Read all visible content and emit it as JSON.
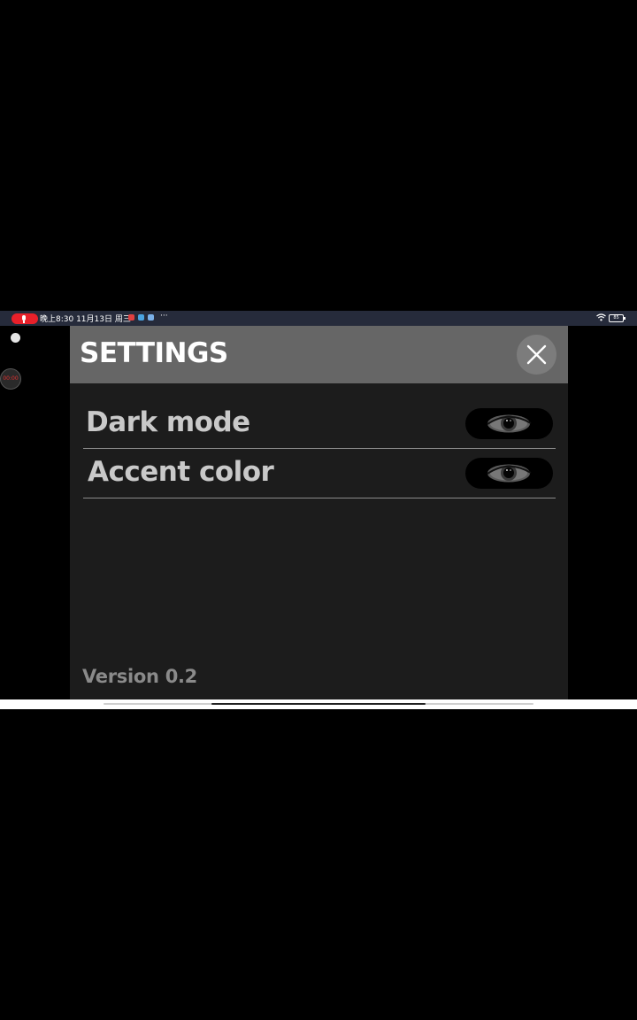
{
  "status_bar": {
    "time_text": "晚上8:30 11月13日 周三",
    "more_text": "···",
    "battery_text": "85",
    "app_icons": [
      "#e04040",
      "#4aa3e0",
      "#7ab0e8"
    ]
  },
  "floating": {
    "timer_text": "00:00"
  },
  "settings": {
    "title": "SETTINGS",
    "items": [
      {
        "label": "Dark mode"
      },
      {
        "label": "Accent color"
      }
    ],
    "version": "Version 0.2"
  },
  "colors": {
    "header_bg": "#666666",
    "panel_bg": "#1c1c1c",
    "label_text": "#c9c9c9",
    "status_bar_bg": "#262b3b",
    "record_red": "#e8202a"
  }
}
